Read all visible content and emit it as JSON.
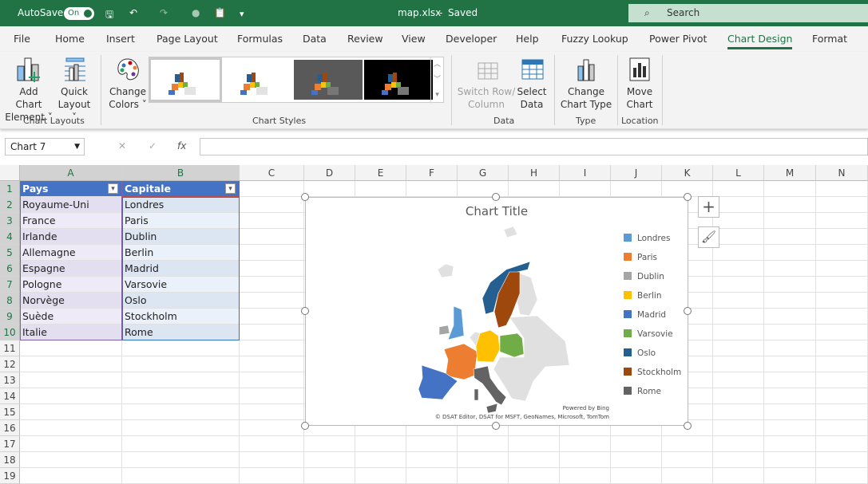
{
  "titlebar": {
    "autosave": "AutoSave",
    "toggle": "On",
    "filename": "map.xlsx",
    "separator": "-",
    "status": "Saved",
    "search": "Search"
  },
  "menu": [
    "File",
    "Home",
    "Insert",
    "Page Layout",
    "Formulas",
    "Data",
    "Review",
    "View",
    "Developer",
    "Help",
    "Fuzzy Lookup",
    "Power Pivot",
    "Chart Design",
    "Format"
  ],
  "active_menu": "Chart Design",
  "ribbon": {
    "add_chart_element": [
      "Add Chart",
      "Element ˅"
    ],
    "quick_layout": [
      "Quick",
      "Layout ˅"
    ],
    "change_colors": [
      "Change",
      "Colors ˅"
    ],
    "switch_row_column": [
      "Switch Row/",
      "Column"
    ],
    "select_data": [
      "Select",
      "Data"
    ],
    "change_chart_type": [
      "Change",
      "Chart Type"
    ],
    "move_chart": [
      "Move",
      "Chart"
    ],
    "groups": {
      "chart_layouts": "Chart Layouts",
      "chart_styles": "Chart Styles",
      "data": "Data",
      "type": "Type",
      "location": "Location"
    }
  },
  "formula_bar": {
    "name_box": "Chart 7",
    "fx": "fx",
    "cancel": "✕",
    "enter": "✓",
    "value": ""
  },
  "columns": [
    "A",
    "B",
    "C",
    "D",
    "E",
    "F",
    "G",
    "H",
    "I",
    "J",
    "K",
    "L",
    "M",
    "N"
  ],
  "rows": [
    "1",
    "2",
    "3",
    "4",
    "5",
    "6",
    "7",
    "8",
    "9",
    "10",
    "11",
    "12",
    "13",
    "14",
    "15",
    "16",
    "17",
    "18",
    "19"
  ],
  "table": {
    "headers": [
      "Pays",
      "Capitale"
    ],
    "rows": [
      [
        "Royaume-Uni",
        "Londres"
      ],
      [
        "France",
        "Paris"
      ],
      [
        "Irlande",
        "Dublin"
      ],
      [
        "Allemagne",
        "Berlin"
      ],
      [
        "Espagne",
        "Madrid"
      ],
      [
        "Pologne",
        "Varsovie"
      ],
      [
        "Norvège",
        "Oslo"
      ],
      [
        "Suède",
        "Stockholm"
      ],
      [
        "Italie",
        "Rome"
      ]
    ]
  },
  "chart": {
    "title": "Chart Title",
    "legend": [
      {
        "label": "Londres",
        "color": "#5b9bd5"
      },
      {
        "label": "Paris",
        "color": "#ed7d31"
      },
      {
        "label": "Dublin",
        "color": "#a5a5a5"
      },
      {
        "label": "Berlin",
        "color": "#ffc000"
      },
      {
        "label": "Madrid",
        "color": "#4472c4"
      },
      {
        "label": "Varsovie",
        "color": "#70ad47"
      },
      {
        "label": "Oslo",
        "color": "#255e91"
      },
      {
        "label": "Stockholm",
        "color": "#9e480e"
      },
      {
        "label": "Rome",
        "color": "#636363"
      }
    ],
    "powered_by": "Powered by Bing",
    "copyright": "© DSAT Editor, DSAT for MSFT, GeoNames, Microsoft, TomTom"
  }
}
